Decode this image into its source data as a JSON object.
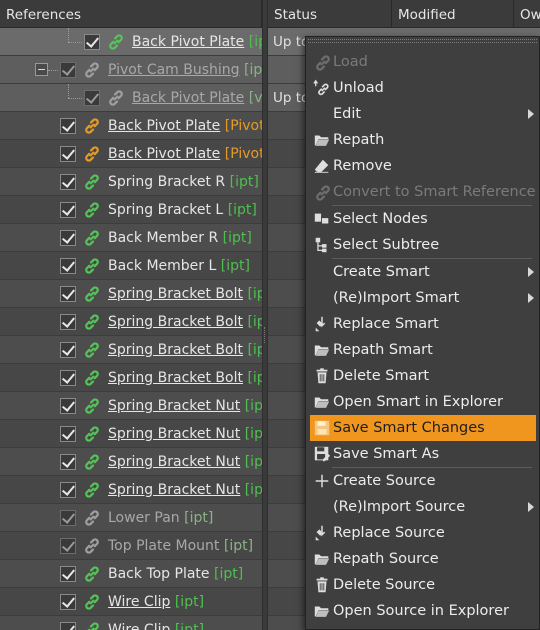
{
  "header": {
    "references": "References",
    "status": "Status",
    "modified": "Modified",
    "owner": "Ow"
  },
  "tree": [
    {
      "name": "Back Pivot Plate",
      "ext": "[ip",
      "style": "u",
      "ext_color": "ext-g",
      "indent": 84,
      "link": "green",
      "dim": false,
      "state": "sel-first"
    },
    {
      "name": "Pivot Cam Bushing",
      "ext": "[ipt]",
      "style": "u",
      "ext_color": "ext-d",
      "indent": 60,
      "link": "grey",
      "dim": true,
      "state": "sel",
      "expander": true
    },
    {
      "name": "Back Pivot Plate",
      "ext": "[v",
      "style": "u",
      "ext_color": "ext-d",
      "indent": 84,
      "link": "grey",
      "dim": true,
      "state": "sel"
    },
    {
      "name": "Back Pivot Plate",
      "ext": "[Pivot",
      "style": "u",
      "ext_color": "ext-o",
      "indent": 60,
      "link": "orange",
      "dim": false,
      "state": "odd"
    },
    {
      "name": "Back Pivot Plate",
      "ext": "[Pivot",
      "style": "u",
      "ext_color": "ext-o",
      "indent": 60,
      "link": "orange",
      "dim": false,
      "state": "even"
    },
    {
      "name": "Spring Bracket R",
      "ext": "[ipt]",
      "style": "",
      "ext_color": "ext-g",
      "indent": 60,
      "link": "green",
      "dim": false,
      "state": "odd"
    },
    {
      "name": "Spring Bracket L",
      "ext": "[ipt]",
      "style": "",
      "ext_color": "ext-g",
      "indent": 60,
      "link": "green",
      "dim": false,
      "state": "even"
    },
    {
      "name": "Back Member R",
      "ext": "[ipt]",
      "style": "",
      "ext_color": "ext-g",
      "indent": 60,
      "link": "green",
      "dim": false,
      "state": "odd"
    },
    {
      "name": "Back Member L",
      "ext": "[ipt]",
      "style": "",
      "ext_color": "ext-g",
      "indent": 60,
      "link": "green",
      "dim": false,
      "state": "even"
    },
    {
      "name": "Spring Bracket Bolt",
      "ext": "[ip",
      "style": "u",
      "ext_color": "ext-g",
      "indent": 60,
      "link": "green",
      "dim": false,
      "state": "odd"
    },
    {
      "name": "Spring Bracket Bolt",
      "ext": "[ip",
      "style": "u",
      "ext_color": "ext-g",
      "indent": 60,
      "link": "green",
      "dim": false,
      "state": "even"
    },
    {
      "name": "Spring Bracket Bolt",
      "ext": "[ip",
      "style": "u",
      "ext_color": "ext-g",
      "indent": 60,
      "link": "green",
      "dim": false,
      "state": "odd"
    },
    {
      "name": "Spring Bracket Bolt",
      "ext": "[ip",
      "style": "u",
      "ext_color": "ext-g",
      "indent": 60,
      "link": "green",
      "dim": false,
      "state": "even"
    },
    {
      "name": "Spring Bracket Nut",
      "ext": "[ipt",
      "style": "u",
      "ext_color": "ext-g",
      "indent": 60,
      "link": "green",
      "dim": false,
      "state": "odd"
    },
    {
      "name": "Spring Bracket Nut",
      "ext": "[ipt",
      "style": "u",
      "ext_color": "ext-g",
      "indent": 60,
      "link": "green",
      "dim": false,
      "state": "even"
    },
    {
      "name": "Spring Bracket Nut",
      "ext": "[ipt",
      "style": "u",
      "ext_color": "ext-g",
      "indent": 60,
      "link": "green",
      "dim": false,
      "state": "odd"
    },
    {
      "name": "Spring Bracket Nut",
      "ext": "[ipt",
      "style": "u",
      "ext_color": "ext-g",
      "indent": 60,
      "link": "green",
      "dim": false,
      "state": "even"
    },
    {
      "name": "Lower Pan",
      "ext": "[ipt]",
      "style": "",
      "ext_color": "ext-d",
      "indent": 60,
      "link": "grey",
      "dim": true,
      "state": "odd"
    },
    {
      "name": "Top Plate Mount",
      "ext": "[ipt]",
      "style": "",
      "ext_color": "ext-d",
      "indent": 60,
      "link": "grey",
      "dim": true,
      "state": "even"
    },
    {
      "name": "Back Top Plate",
      "ext": "[ipt]",
      "style": "",
      "ext_color": "ext-g",
      "indent": 60,
      "link": "green",
      "dim": false,
      "state": "odd"
    },
    {
      "name": "Wire Clip",
      "ext": "[ipt]",
      "style": "u",
      "ext_color": "ext-g",
      "indent": 60,
      "link": "green",
      "dim": false,
      "state": "even"
    },
    {
      "name": "Wire Clip",
      "ext": "[ipt]",
      "style": "u",
      "ext_color": "ext-g",
      "indent": 60,
      "link": "green",
      "dim": false,
      "state": "odd"
    }
  ],
  "status_col": [
    "Up to",
    "",
    "Up to"
  ],
  "menu": [
    {
      "label": "Load",
      "icon": "link-icon",
      "disabled": true
    },
    {
      "label": "Unload",
      "icon": "unload-icon"
    },
    {
      "label": "Edit",
      "icon": "",
      "submenu": true
    },
    {
      "label": "Repath",
      "icon": "folder-open-icon"
    },
    {
      "label": "Remove",
      "icon": "eraser-icon"
    },
    {
      "label": "Convert to Smart Reference",
      "icon": "link-icon",
      "disabled": true,
      "sep_after": true
    },
    {
      "label": "Select Nodes",
      "icon": "select-nodes-icon"
    },
    {
      "label": "Select Subtree",
      "icon": "select-subtree-icon",
      "sep_after": true
    },
    {
      "label": "Create Smart",
      "icon": "",
      "submenu": true
    },
    {
      "label": "(Re)Import Smart",
      "icon": "",
      "submenu": true
    },
    {
      "label": "Replace Smart",
      "icon": "replace-icon"
    },
    {
      "label": "Repath Smart",
      "icon": "folder-open-icon"
    },
    {
      "label": "Delete Smart",
      "icon": "trash-icon"
    },
    {
      "label": "Open Smart in Explorer",
      "icon": "folder-open-icon"
    },
    {
      "label": "Save Smart Changes",
      "icon": "save-icon",
      "highlight": true
    },
    {
      "label": "Save Smart As",
      "icon": "save-as-icon",
      "sep_after": true
    },
    {
      "label": "Create Source",
      "icon": "plus-icon"
    },
    {
      "label": "(Re)Import Source",
      "icon": "",
      "submenu": true
    },
    {
      "label": "Replace Source",
      "icon": "replace-icon"
    },
    {
      "label": "Repath Source",
      "icon": "folder-open-icon"
    },
    {
      "label": "Delete Source",
      "icon": "trash-icon"
    },
    {
      "label": "Open Source in Explorer",
      "icon": "folder-open-icon"
    }
  ],
  "colors": {
    "highlight": "#f0961e",
    "ext_green": "#4fbf4f",
    "ext_orange": "#e59b28"
  }
}
